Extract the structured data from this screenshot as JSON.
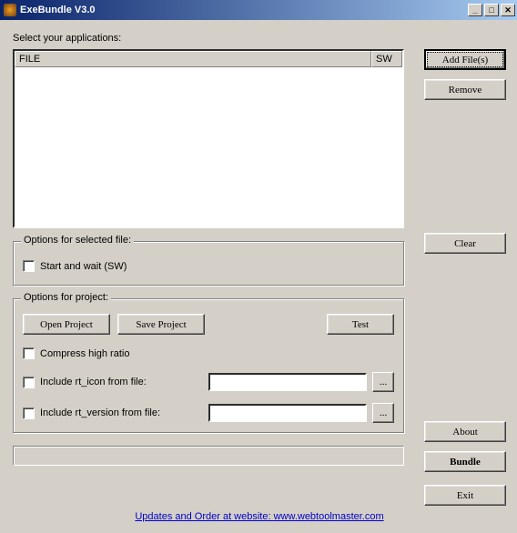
{
  "window": {
    "title": "ExeBundle V3.0"
  },
  "header": {
    "select_label": "Select your applications:"
  },
  "listview": {
    "col_file": "FILE",
    "col_sw": "SW"
  },
  "buttons": {
    "add": "Add File(s)",
    "remove": "Remove",
    "clear": "Clear",
    "about": "About",
    "bundle": "Bundle",
    "exit": "Exit"
  },
  "group_selected": {
    "legend": "Options for selected file:",
    "start_wait": "Start and wait (SW)"
  },
  "group_project": {
    "legend": "Options for project:",
    "open": "Open Project",
    "save": "Save Project",
    "test": "Test",
    "compress": "Compress high ratio",
    "include_icon": "Include rt_icon from file:",
    "include_version": "Include rt_version from file:",
    "browse": "..."
  },
  "footer": {
    "prefix": "Updates and Order at website: ",
    "link": "www.webtoolmaster.com"
  }
}
